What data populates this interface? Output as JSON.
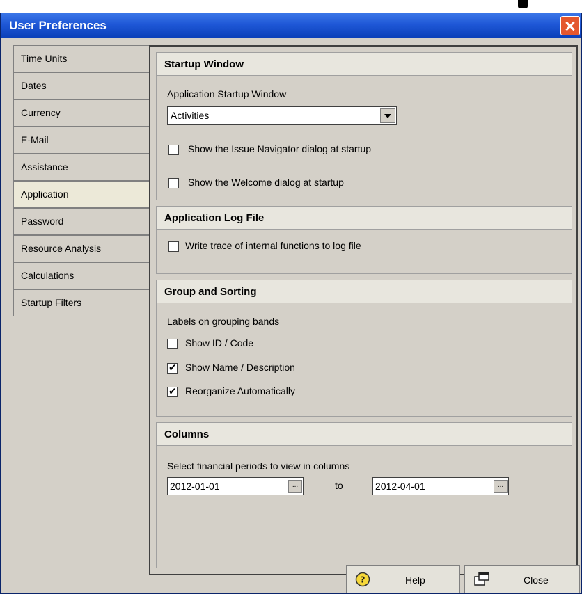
{
  "window": {
    "title": "User Preferences"
  },
  "tabs": [
    {
      "label": "Time Units"
    },
    {
      "label": "Dates"
    },
    {
      "label": "Currency"
    },
    {
      "label": "E-Mail"
    },
    {
      "label": "Assistance"
    },
    {
      "label": "Application"
    },
    {
      "label": "Password"
    },
    {
      "label": "Resource Analysis"
    },
    {
      "label": "Calculations"
    },
    {
      "label": "Startup Filters"
    }
  ],
  "startup": {
    "header": "Startup Window",
    "field_label": "Application Startup Window",
    "selected": "Activities",
    "options": [
      {
        "label": "Show the Issue Navigator dialog at startup",
        "checked": false
      },
      {
        "label": "Show the Welcome dialog at startup",
        "checked": false
      }
    ]
  },
  "logfile": {
    "header": "Application Log File",
    "options": [
      {
        "label": "Write trace of internal functions to log file",
        "checked": false
      }
    ]
  },
  "grouping": {
    "header": "Group and Sorting",
    "subtitle": "Labels on grouping bands",
    "options": [
      {
        "label": "Show ID / Code",
        "checked": false
      },
      {
        "label": "Show Name / Description",
        "checked": true
      },
      {
        "label": "Reorganize Automatically",
        "checked": true
      }
    ]
  },
  "columns": {
    "header": "Columns",
    "label": "Select financial periods to view in columns",
    "from": "2012-01-01",
    "to_label": "to",
    "to": "2012-04-01",
    "browse": "..."
  },
  "footer": {
    "help": "Help",
    "close": "Close"
  },
  "icons": {
    "help": "help-icon",
    "close": "close-window-icon",
    "title_close": "close-icon"
  }
}
